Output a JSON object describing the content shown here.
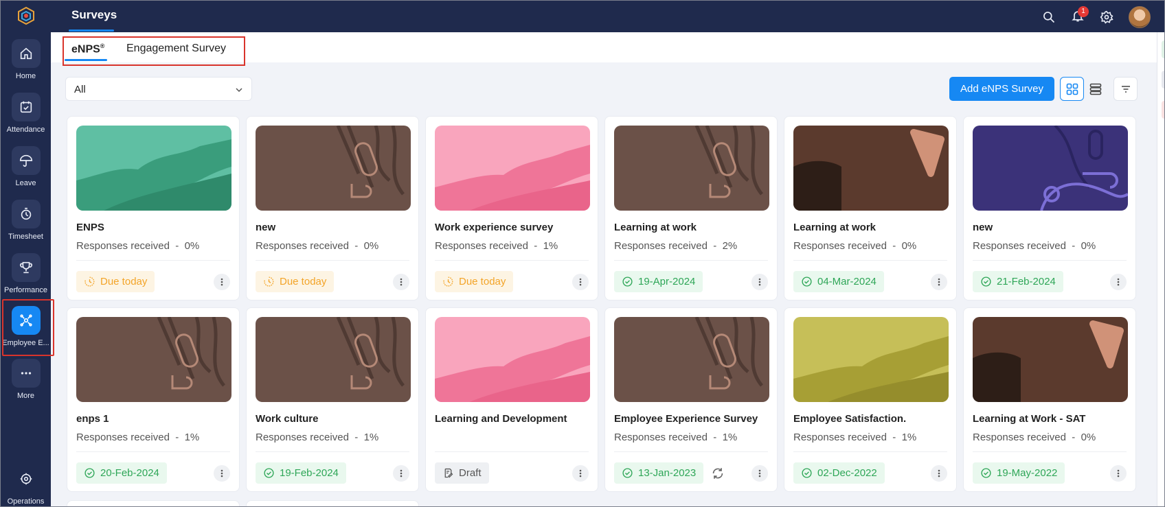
{
  "app": {
    "title": "Surveys"
  },
  "sidebar": {
    "items": [
      {
        "label": "Home",
        "icon": "home-icon"
      },
      {
        "label": "Attendance",
        "icon": "calendar-check-icon"
      },
      {
        "label": "Leave",
        "icon": "umbrella-icon"
      },
      {
        "label": "Timesheet",
        "icon": "stopwatch-icon"
      },
      {
        "label": "Performance",
        "icon": "trophy-icon"
      },
      {
        "label": "Employee E...",
        "icon": "engagement-icon"
      },
      {
        "label": "More",
        "icon": "more-dots-icon"
      },
      {
        "label": "Operations",
        "icon": "operations-icon"
      }
    ]
  },
  "header": {
    "notification_count": "1"
  },
  "tabs": [
    {
      "label": "eNPS",
      "mark": "®"
    },
    {
      "label": "Engagement Survey"
    }
  ],
  "toolbar": {
    "filter_value": "All",
    "add_label": "Add eNPS Survey"
  },
  "colors": {
    "accent": "#1688f3",
    "nav_bg": "#1f2a4d",
    "due": "#f3a428",
    "done": "#2ea657"
  },
  "cards": [
    {
      "title": "ENPS",
      "responses_label": "Responses received",
      "responses": "0%",
      "status": "Due today",
      "status_type": "due",
      "thumb": "green"
    },
    {
      "title": "new",
      "responses_label": "Responses received",
      "responses": "0%",
      "status": "Due today",
      "status_type": "due",
      "thumb": "brown-pattern"
    },
    {
      "title": "Work experience survey",
      "responses_label": "Responses received",
      "responses": "1%",
      "status": "Due today",
      "status_type": "due",
      "thumb": "pink"
    },
    {
      "title": "Learning at work",
      "responses_label": "Responses received",
      "responses": "2%",
      "status": "19-Apr-2024",
      "status_type": "done",
      "thumb": "brown-pattern"
    },
    {
      "title": "Learning at work",
      "responses_label": "Responses received",
      "responses": "0%",
      "status": "04-Mar-2024",
      "status_type": "done",
      "thumb": "brown-shapes"
    },
    {
      "title": "new",
      "responses_label": "Responses received",
      "responses": "0%",
      "status": "21-Feb-2024",
      "status_type": "done",
      "thumb": "purple"
    },
    {
      "title": "enps 1",
      "responses_label": "Responses received",
      "responses": "1%",
      "status": "20-Feb-2024",
      "status_type": "done",
      "thumb": "brown-pattern"
    },
    {
      "title": "Work culture",
      "responses_label": "Responses received",
      "responses": "1%",
      "status": "19-Feb-2024",
      "status_type": "done",
      "thumb": "brown-pattern"
    },
    {
      "title": "Learning and Development",
      "responses_label": "",
      "responses": "",
      "status": "Draft",
      "status_type": "draft",
      "thumb": "pink"
    },
    {
      "title": "Employee Experience Survey",
      "responses_label": "Responses received",
      "responses": "1%",
      "status": "13-Jan-2023",
      "status_type": "done",
      "thumb": "brown-pattern",
      "sync": true
    },
    {
      "title": "Employee Satisfaction.",
      "responses_label": "Responses received",
      "responses": "1%",
      "status": "02-Dec-2022",
      "status_type": "done",
      "thumb": "olive"
    },
    {
      "title": "Learning at Work - SAT",
      "responses_label": "Responses received",
      "responses": "0%",
      "status": "19-May-2022",
      "status_type": "done",
      "thumb": "brown-shapes"
    }
  ]
}
